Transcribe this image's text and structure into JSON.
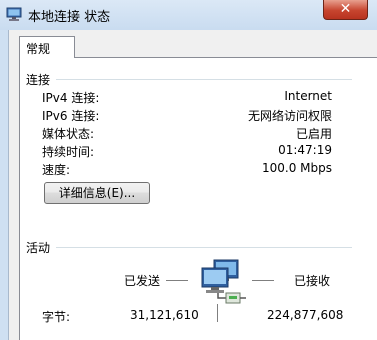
{
  "window": {
    "title": "本地连接 状态",
    "close_glyph": "✕"
  },
  "tabs": [
    {
      "label": "常规"
    }
  ],
  "connection": {
    "group_label": "连接",
    "rows": [
      {
        "label": "IPv4 连接:",
        "value": "Internet"
      },
      {
        "label": "IPv6 连接:",
        "value": "无网络访问权限"
      },
      {
        "label": "媒体状态:",
        "value": "已启用"
      },
      {
        "label": "持续时间:",
        "value": "01:47:19"
      },
      {
        "label": "速度:",
        "value": "100.0 Mbps"
      }
    ],
    "details_button": "详细信息(E)..."
  },
  "activity": {
    "group_label": "活动",
    "sent_label": "已发送",
    "received_label": "已接收",
    "bytes_label": "字节:",
    "bytes_sent": "31,121,610",
    "bytes_received": "224,877,608"
  },
  "icons": {
    "app": "network-connection-icon",
    "activity": "network-activity-icon"
  }
}
